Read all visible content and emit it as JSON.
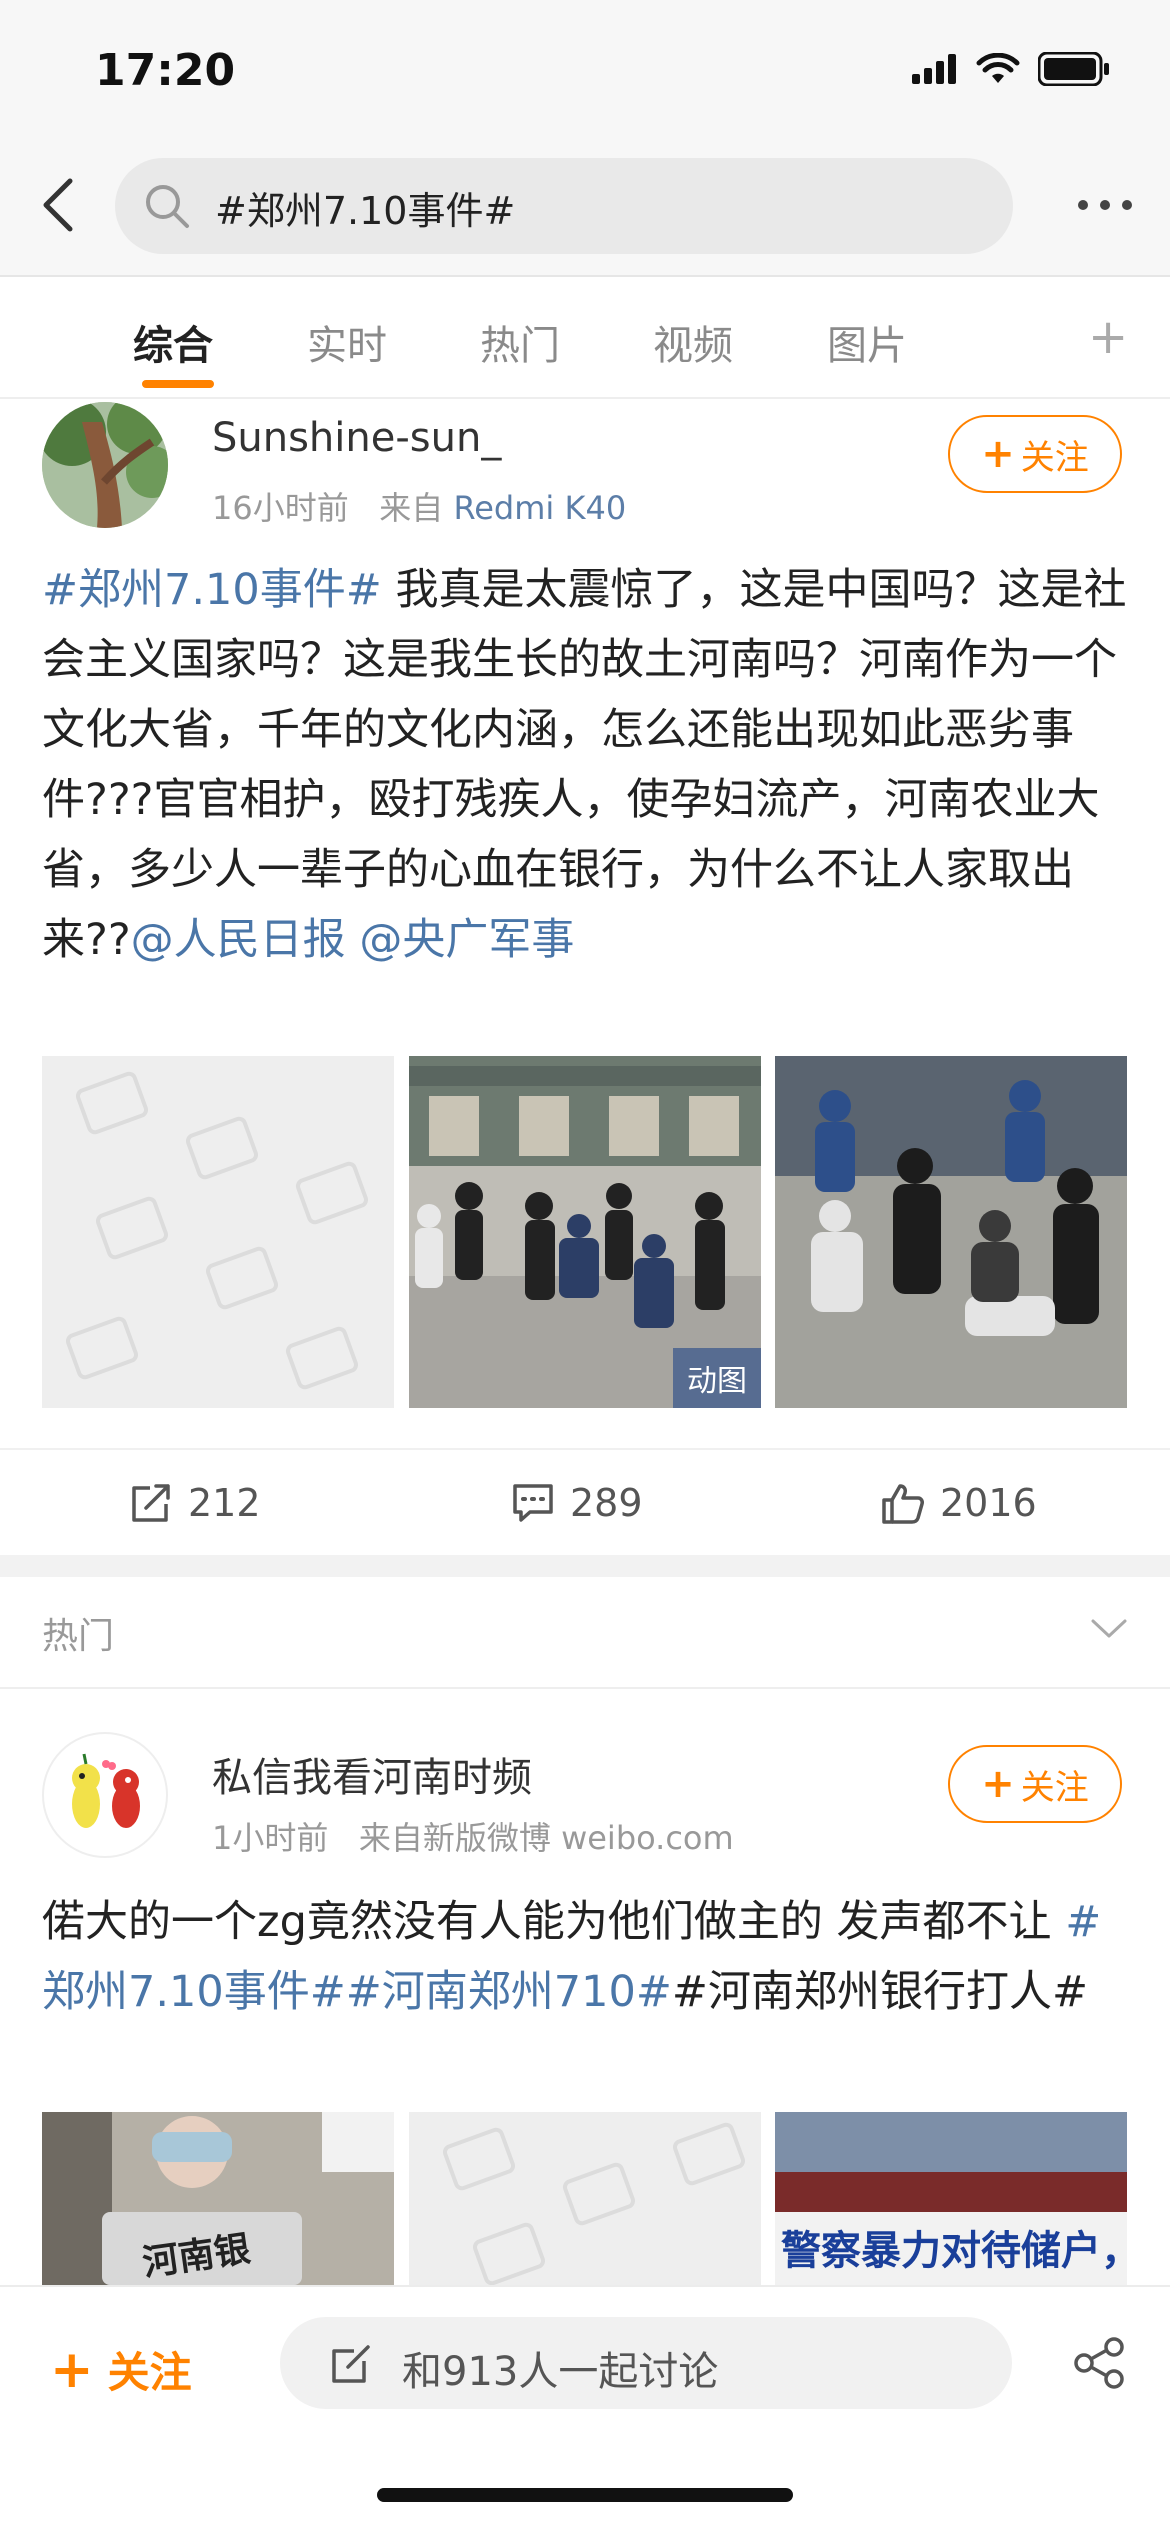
{
  "status": {
    "time": "17:20"
  },
  "search": {
    "query": "#郑州7.10事件#"
  },
  "tabs": [
    {
      "label": "综合",
      "active": true
    },
    {
      "label": "实时",
      "active": false
    },
    {
      "label": "热门",
      "active": false
    },
    {
      "label": "视频",
      "active": false
    },
    {
      "label": "图片",
      "active": false
    }
  ],
  "post1": {
    "username": "Sunshine-sun_",
    "time": "16小时前",
    "source_prefix": "来自",
    "device": "Redmi K40",
    "follow_label": "关注",
    "hashtag": "#郑州7.10事件#",
    "body": " 我真是太震惊了，这是中国吗？这是社会主义国家吗？这是我生长的故土河南吗？河南作为一个文化大省，千年的文化内涵，怎么还能出现如此恶劣事件???官官相护，殴打残疾人，使孕妇流产，河南农业大省，多少人一辈子的心血在银行，为什么不让人家取出来??",
    "mention1": "@人民日报",
    "mention2": "@央广军事",
    "gif_badge": "动图",
    "reposts": "212",
    "comments": "289",
    "likes": "2016"
  },
  "hot_section": {
    "label": "热门"
  },
  "post2": {
    "username": "私信我看河南时频",
    "time": "1小时前",
    "source": "来自新版微博 weibo.com",
    "follow_label": "关注",
    "body_plain": "偌大的一个zg竟然没有人能为他们做主的 发声都不让 ",
    "tag1": "#郑州7.10事件#",
    "tag2": "#河南郑州710#",
    "body_tail": "#河南郑州银行打人#",
    "img1_text": "河南银",
    "img3_text": "警察暴力对待储户，"
  },
  "bottom": {
    "follow_label": "关注",
    "discuss_text": "和913人一起讨论"
  },
  "colors": {
    "accent": "#ff8200",
    "link": "#4a76a8"
  }
}
